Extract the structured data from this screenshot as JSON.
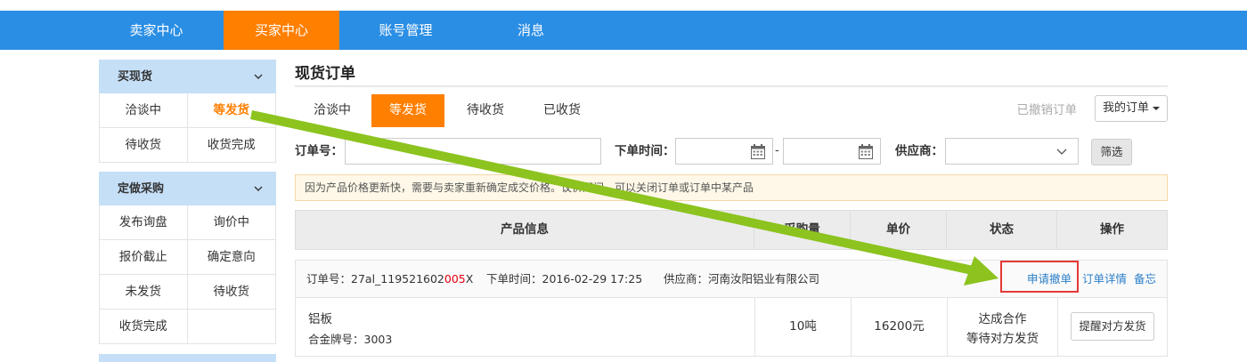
{
  "topnav": {
    "items": [
      {
        "label": "卖家中心"
      },
      {
        "label": "买家中心"
      },
      {
        "label": "账号管理"
      },
      {
        "label": "消息"
      }
    ],
    "active_color": "#ff7f00",
    "bar_color": "#2a8ee4"
  },
  "sidebar": {
    "groups": [
      {
        "title": "买现货",
        "rows": [
          [
            "洽谈中",
            "等发货"
          ],
          [
            "待收货",
            "收货完成"
          ]
        ]
      },
      {
        "title": "定做采购",
        "rows": [
          [
            "发布询盘",
            "询价中"
          ],
          [
            "报价截止",
            "确定意向"
          ],
          [
            "未发货",
            "待收货"
          ],
          [
            "收货完成",
            ""
          ]
        ]
      }
    ],
    "active_item": "等发货"
  },
  "main": {
    "title": "现货订单",
    "tabs": [
      {
        "label": "洽谈中"
      },
      {
        "label": "等发货"
      },
      {
        "label": "待收货"
      },
      {
        "label": "已收货"
      }
    ],
    "revoked_link": "已撤销订单",
    "my_orders_label": "我的订单",
    "filters": {
      "order_no_label": "订单号：",
      "order_time_label": "下单时间：",
      "date_separator": "-",
      "supplier_label": "供应商：",
      "search_button": "筛选"
    },
    "notice": "因为产品价格更新快，需要与卖家重新确定成交价格。议价期间，可以关闭订单或订单中某产品",
    "table": {
      "headers": [
        "产品信息",
        "采购量",
        "单价",
        "状态",
        "操作"
      ]
    },
    "order": {
      "order_no_label": "订单号：",
      "order_no_prefix": "27al_119521602",
      "order_no_highlight": "005",
      "order_no_suffix": "X",
      "time_label": "下单时间：",
      "time_value": "2016-02-29 17:25",
      "supplier_label": "供应商：",
      "supplier_value": "河南汝阳铝业有限公司",
      "actions": {
        "cancel": "申请撤单",
        "detail": "订单详情",
        "note": "备忘"
      },
      "item": {
        "name": "铝板",
        "grade_label": "合金牌号：",
        "grade_value": "3003",
        "quantity": "10吨",
        "price": "16200元",
        "status_line1": "达成合作",
        "status_line2": "等待对方发货",
        "remind_button": "提醒对方发货"
      }
    }
  },
  "annotation": {
    "arrow_color": "#8cc31f",
    "highlight_box_color": "#e53935"
  }
}
